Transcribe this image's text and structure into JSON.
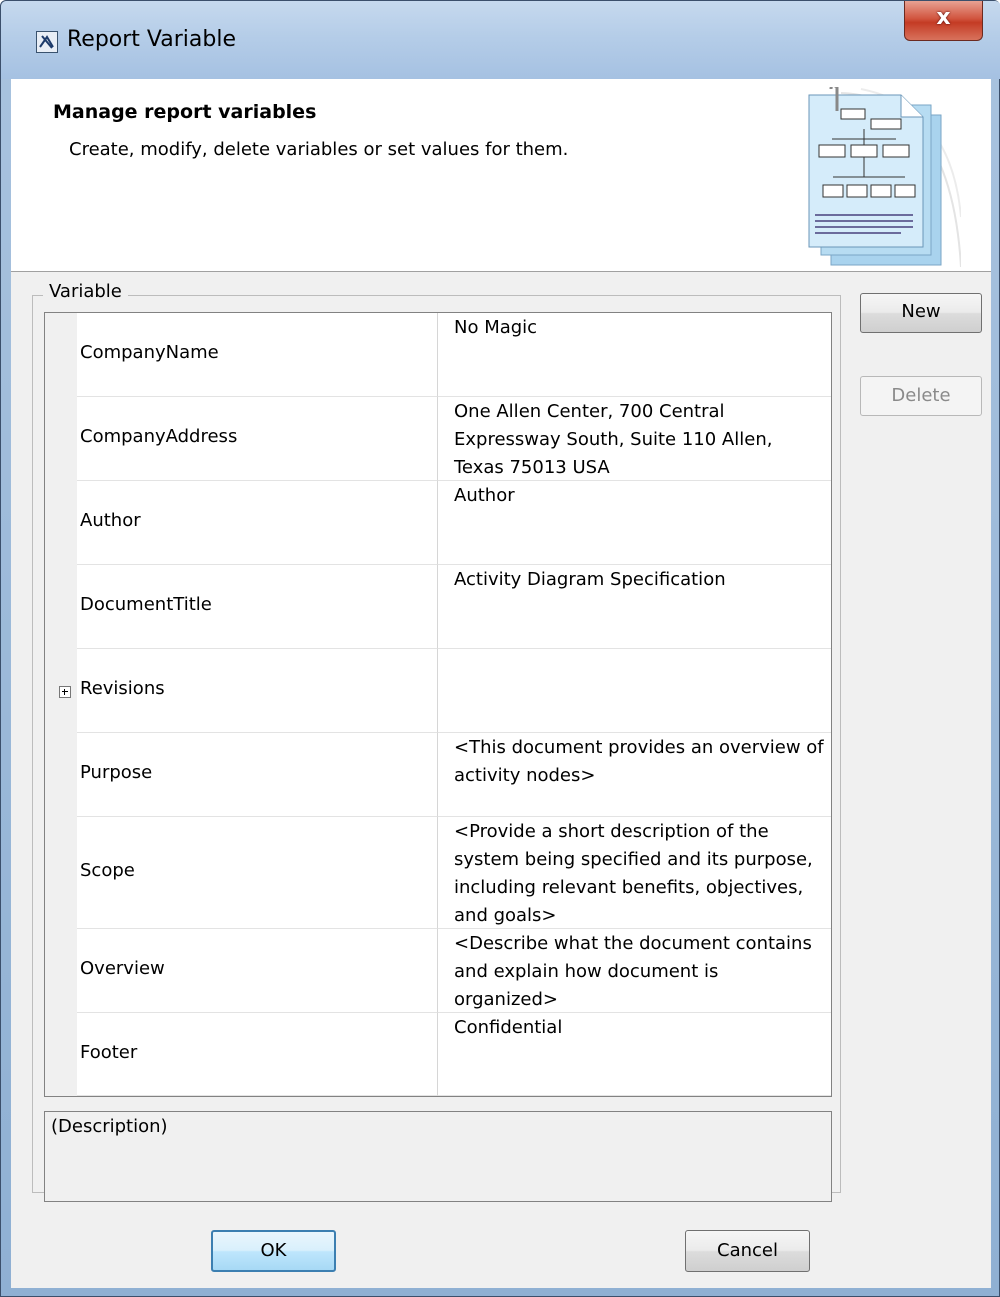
{
  "window": {
    "title": "Report Variable",
    "close_label": "x"
  },
  "header": {
    "title": "Manage report variables",
    "description": "Create, modify, delete variables or set values for them."
  },
  "group": {
    "label": "Variable"
  },
  "variables": [
    {
      "name": "CompanyName",
      "value": "No Magic"
    },
    {
      "name": "CompanyAddress",
      "value": "One Allen Center, 700 Central Expressway South, Suite 110 Allen, Texas 75013 USA"
    },
    {
      "name": "Author",
      "value": "Author"
    },
    {
      "name": "DocumentTitle",
      "value": "Activity Diagram Specification"
    },
    {
      "name": "Revisions",
      "value": ""
    },
    {
      "name": "Purpose",
      "value": "<This document provides an overview of activity nodes>"
    },
    {
      "name": "Scope",
      "value": "<Provide a short description of the system being specified and its purpose, including relevant benefits, objectives, and goals>"
    },
    {
      "name": "Overview",
      "value": "<Describe what the document contains and explain how document is organized>"
    },
    {
      "name": "Footer",
      "value": "Confidential"
    }
  ],
  "description_box": {
    "text": "(Description)"
  },
  "buttons": {
    "new": "New",
    "delete": "Delete",
    "ok": "OK",
    "cancel": "Cancel"
  },
  "colors": {
    "title_bar": "#b5cde8",
    "close_button": "#c43b24",
    "dialog_background": "#f0f0f0",
    "focus_border": "#3c7fb1"
  }
}
